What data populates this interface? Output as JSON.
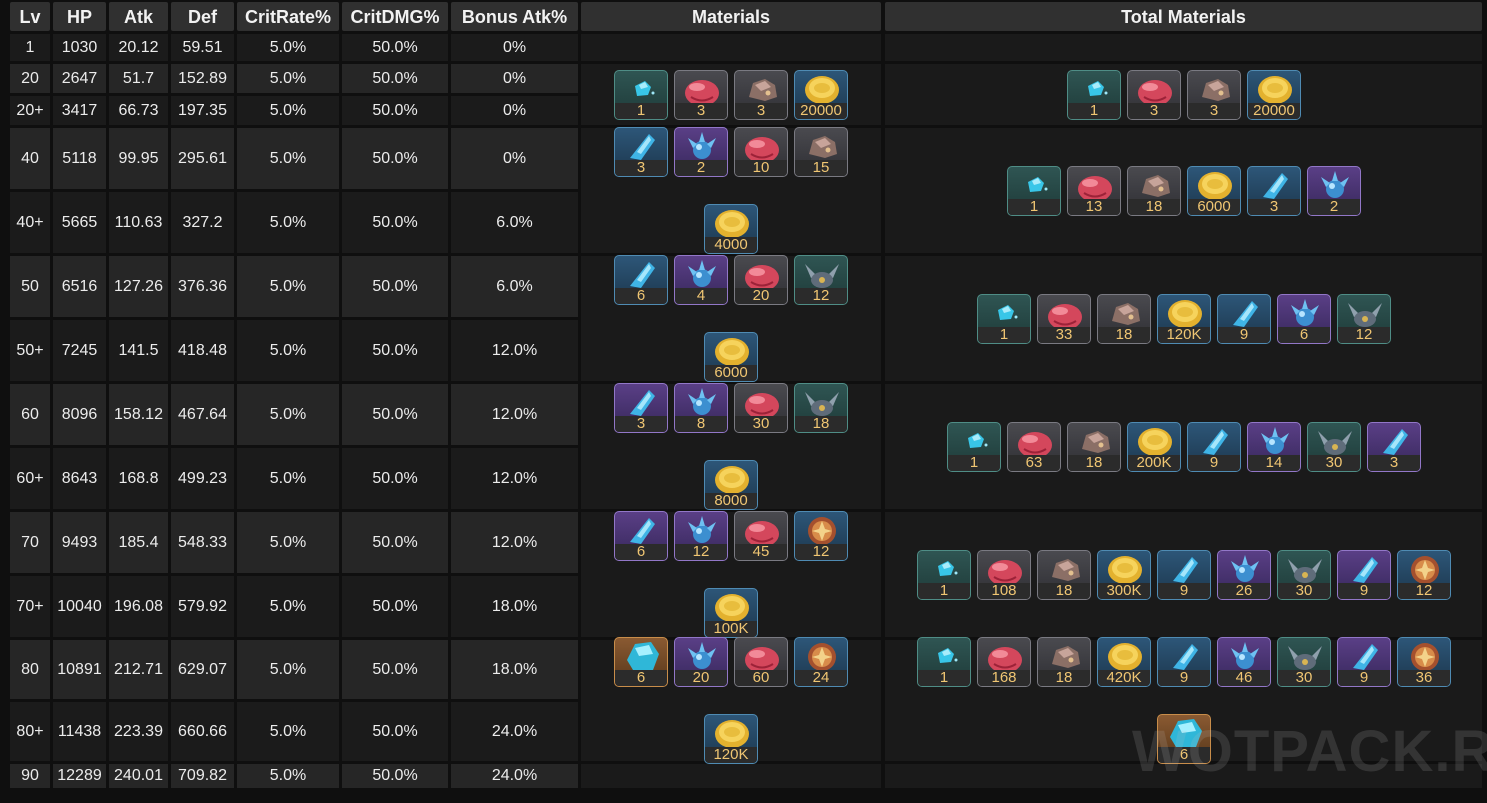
{
  "headers": {
    "lv": "Lv",
    "hp": "HP",
    "atk": "Atk",
    "def": "Def",
    "crit_rate": "CritRate%",
    "crit_dmg": "CritDMG%",
    "bonus_atk": "Bonus Atk%",
    "materials": "Materials",
    "total_materials": "Total Materials"
  },
  "rows": [
    {
      "lv": "1",
      "hp": "1030",
      "atk": "20.12",
      "def": "59.51",
      "crit_rate": "5.0%",
      "crit_dmg": "50.0%",
      "bonus_atk": "0%"
    },
    {
      "lv": "20",
      "hp": "2647",
      "atk": "51.7",
      "def": "152.89",
      "crit_rate": "5.0%",
      "crit_dmg": "50.0%",
      "bonus_atk": "0%"
    },
    {
      "lv": "20+",
      "hp": "3417",
      "atk": "66.73",
      "def": "197.35",
      "crit_rate": "5.0%",
      "crit_dmg": "50.0%",
      "bonus_atk": "0%"
    },
    {
      "lv": "40",
      "hp": "5118",
      "atk": "99.95",
      "def": "295.61",
      "crit_rate": "5.0%",
      "crit_dmg": "50.0%",
      "bonus_atk": "0%"
    },
    {
      "lv": "40+",
      "hp": "5665",
      "atk": "110.63",
      "def": "327.2",
      "crit_rate": "5.0%",
      "crit_dmg": "50.0%",
      "bonus_atk": "6.0%"
    },
    {
      "lv": "50",
      "hp": "6516",
      "atk": "127.26",
      "def": "376.36",
      "crit_rate": "5.0%",
      "crit_dmg": "50.0%",
      "bonus_atk": "6.0%"
    },
    {
      "lv": "50+",
      "hp": "7245",
      "atk": "141.5",
      "def": "418.48",
      "crit_rate": "5.0%",
      "crit_dmg": "50.0%",
      "bonus_atk": "12.0%"
    },
    {
      "lv": "60",
      "hp": "8096",
      "atk": "158.12",
      "def": "467.64",
      "crit_rate": "5.0%",
      "crit_dmg": "50.0%",
      "bonus_atk": "12.0%"
    },
    {
      "lv": "60+",
      "hp": "8643",
      "atk": "168.8",
      "def": "499.23",
      "crit_rate": "5.0%",
      "crit_dmg": "50.0%",
      "bonus_atk": "12.0%"
    },
    {
      "lv": "70",
      "hp": "9493",
      "atk": "185.4",
      "def": "548.33",
      "crit_rate": "5.0%",
      "crit_dmg": "50.0%",
      "bonus_atk": "12.0%"
    },
    {
      "lv": "70+",
      "hp": "10040",
      "atk": "196.08",
      "def": "579.92",
      "crit_rate": "5.0%",
      "crit_dmg": "50.0%",
      "bonus_atk": "18.0%"
    },
    {
      "lv": "80",
      "hp": "10891",
      "atk": "212.71",
      "def": "629.07",
      "crit_rate": "5.0%",
      "crit_dmg": "50.0%",
      "bonus_atk": "18.0%"
    },
    {
      "lv": "80+",
      "hp": "11438",
      "atk": "223.39",
      "def": "660.66",
      "crit_rate": "5.0%",
      "crit_dmg": "50.0%",
      "bonus_atk": "24.0%"
    },
    {
      "lv": "90",
      "hp": "12289",
      "atk": "240.01",
      "def": "709.82",
      "crit_rate": "5.0%",
      "crit_dmg": "50.0%",
      "bonus_atk": "24.0%"
    }
  ],
  "material_groups": [
    {
      "materials": [
        {
          "icon": "small-crystal-icon",
          "rarity": "green",
          "count": "1"
        },
        {
          "icon": "red-fruit-icon",
          "rarity": "gray",
          "count": "3"
        },
        {
          "icon": "ore-chunk-icon",
          "rarity": "gray",
          "count": "3"
        },
        {
          "icon": "gold-coin-icon",
          "rarity": "blue",
          "count": "20000"
        }
      ],
      "total": [
        {
          "icon": "small-crystal-icon",
          "rarity": "green",
          "count": "1"
        },
        {
          "icon": "red-fruit-icon",
          "rarity": "gray",
          "count": "3"
        },
        {
          "icon": "ore-chunk-icon",
          "rarity": "gray",
          "count": "3"
        },
        {
          "icon": "gold-coin-icon",
          "rarity": "blue",
          "count": "20000"
        }
      ]
    },
    {
      "materials": [
        {
          "icon": "crystal-shard-icon",
          "rarity": "blue",
          "count": "3"
        },
        {
          "icon": "spiked-orb-icon",
          "rarity": "purple",
          "count": "2"
        },
        {
          "icon": "red-fruit-icon",
          "rarity": "gray",
          "count": "10"
        },
        {
          "icon": "ore-chunk-icon",
          "rarity": "gray",
          "count": "15"
        },
        {
          "icon": "gold-coin-icon",
          "rarity": "blue",
          "count": "4000"
        }
      ],
      "total": [
        {
          "icon": "small-crystal-icon",
          "rarity": "green",
          "count": "1"
        },
        {
          "icon": "red-fruit-icon",
          "rarity": "gray",
          "count": "13"
        },
        {
          "icon": "ore-chunk-icon",
          "rarity": "gray",
          "count": "18"
        },
        {
          "icon": "gold-coin-icon",
          "rarity": "blue",
          "count": "6000"
        },
        {
          "icon": "crystal-shard-icon",
          "rarity": "blue",
          "count": "3"
        },
        {
          "icon": "spiked-orb-icon",
          "rarity": "purple",
          "count": "2"
        }
      ]
    },
    {
      "materials": [
        {
          "icon": "crystal-shard-icon",
          "rarity": "blue",
          "count": "6"
        },
        {
          "icon": "spiked-orb-icon",
          "rarity": "purple",
          "count": "4"
        },
        {
          "icon": "red-fruit-icon",
          "rarity": "gray",
          "count": "20"
        },
        {
          "icon": "horned-relic-icon",
          "rarity": "green",
          "count": "12"
        },
        {
          "icon": "gold-coin-icon",
          "rarity": "blue",
          "count": "6000"
        }
      ],
      "total": [
        {
          "icon": "small-crystal-icon",
          "rarity": "green",
          "count": "1"
        },
        {
          "icon": "red-fruit-icon",
          "rarity": "gray",
          "count": "33"
        },
        {
          "icon": "ore-chunk-icon",
          "rarity": "gray",
          "count": "18"
        },
        {
          "icon": "gold-coin-icon",
          "rarity": "blue",
          "count": "120K"
        },
        {
          "icon": "crystal-shard-icon",
          "rarity": "blue",
          "count": "9"
        },
        {
          "icon": "spiked-orb-icon",
          "rarity": "purple",
          "count": "6"
        },
        {
          "icon": "horned-relic-icon",
          "rarity": "green",
          "count": "12"
        }
      ]
    },
    {
      "materials": [
        {
          "icon": "crystal-shard-icon",
          "rarity": "purple",
          "count": "3"
        },
        {
          "icon": "spiked-orb-icon",
          "rarity": "purple",
          "count": "8"
        },
        {
          "icon": "red-fruit-icon",
          "rarity": "gray",
          "count": "30"
        },
        {
          "icon": "horned-relic-icon",
          "rarity": "green",
          "count": "18"
        },
        {
          "icon": "gold-coin-icon",
          "rarity": "blue",
          "count": "8000"
        }
      ],
      "total": [
        {
          "icon": "small-crystal-icon",
          "rarity": "green",
          "count": "1"
        },
        {
          "icon": "red-fruit-icon",
          "rarity": "gray",
          "count": "63"
        },
        {
          "icon": "ore-chunk-icon",
          "rarity": "gray",
          "count": "18"
        },
        {
          "icon": "gold-coin-icon",
          "rarity": "blue",
          "count": "200K"
        },
        {
          "icon": "crystal-shard-icon",
          "rarity": "blue",
          "count": "9"
        },
        {
          "icon": "spiked-orb-icon",
          "rarity": "purple",
          "count": "14"
        },
        {
          "icon": "horned-relic-icon",
          "rarity": "green",
          "count": "30"
        },
        {
          "icon": "crystal-shard-icon",
          "rarity": "purple",
          "count": "3"
        }
      ]
    },
    {
      "materials": [
        {
          "icon": "crystal-shard-icon",
          "rarity": "purple",
          "count": "6"
        },
        {
          "icon": "spiked-orb-icon",
          "rarity": "purple",
          "count": "12"
        },
        {
          "icon": "red-fruit-icon",
          "rarity": "gray",
          "count": "45"
        },
        {
          "icon": "ornate-relic-icon",
          "rarity": "blue",
          "count": "12"
        },
        {
          "icon": "gold-coin-icon",
          "rarity": "blue",
          "count": "100K"
        }
      ],
      "total": [
        {
          "icon": "small-crystal-icon",
          "rarity": "green",
          "count": "1"
        },
        {
          "icon": "red-fruit-icon",
          "rarity": "gray",
          "count": "108"
        },
        {
          "icon": "ore-chunk-icon",
          "rarity": "gray",
          "count": "18"
        },
        {
          "icon": "gold-coin-icon",
          "rarity": "blue",
          "count": "300K"
        },
        {
          "icon": "crystal-shard-icon",
          "rarity": "blue",
          "count": "9"
        },
        {
          "icon": "spiked-orb-icon",
          "rarity": "purple",
          "count": "26"
        },
        {
          "icon": "horned-relic-icon",
          "rarity": "green",
          "count": "30"
        },
        {
          "icon": "crystal-shard-icon",
          "rarity": "purple",
          "count": "9"
        },
        {
          "icon": "ornate-relic-icon",
          "rarity": "blue",
          "count": "12"
        }
      ]
    },
    {
      "materials": [
        {
          "icon": "large-crystal-icon",
          "rarity": "gold",
          "count": "6"
        },
        {
          "icon": "spiked-orb-icon",
          "rarity": "purple",
          "count": "20"
        },
        {
          "icon": "red-fruit-icon",
          "rarity": "gray",
          "count": "60"
        },
        {
          "icon": "ornate-relic-icon",
          "rarity": "blue",
          "count": "24"
        },
        {
          "icon": "gold-coin-icon",
          "rarity": "blue",
          "count": "120K"
        }
      ],
      "total": [
        {
          "icon": "small-crystal-icon",
          "rarity": "green",
          "count": "1"
        },
        {
          "icon": "red-fruit-icon",
          "rarity": "gray",
          "count": "168"
        },
        {
          "icon": "ore-chunk-icon",
          "rarity": "gray",
          "count": "18"
        },
        {
          "icon": "gold-coin-icon",
          "rarity": "blue",
          "count": "420K"
        },
        {
          "icon": "crystal-shard-icon",
          "rarity": "blue",
          "count": "9"
        },
        {
          "icon": "spiked-orb-icon",
          "rarity": "purple",
          "count": "46"
        },
        {
          "icon": "horned-relic-icon",
          "rarity": "green",
          "count": "30"
        },
        {
          "icon": "crystal-shard-icon",
          "rarity": "purple",
          "count": "9"
        },
        {
          "icon": "ornate-relic-icon",
          "rarity": "blue",
          "count": "36"
        },
        {
          "icon": "large-crystal-icon",
          "rarity": "gold",
          "count": "6"
        }
      ]
    }
  ],
  "watermark": "WOTPACK.RU",
  "colors": {
    "header_bg": "#303030",
    "row_even": "#1b1b1b",
    "row_odd": "#262626",
    "count_text": "#f0c673"
  }
}
